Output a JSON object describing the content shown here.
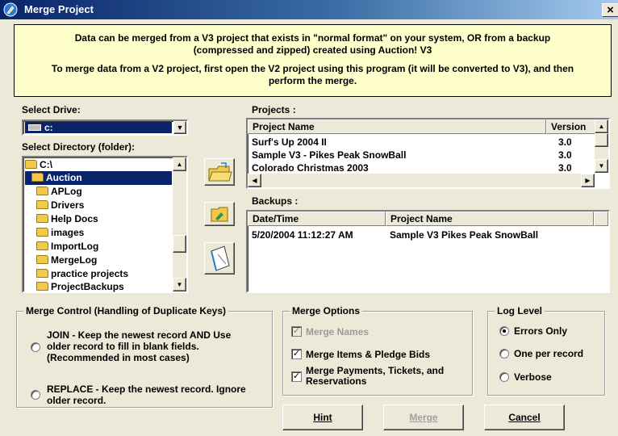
{
  "window": {
    "title": "Merge Project",
    "close_glyph": "×"
  },
  "info": {
    "line1": "Data can be merged from a V3 project that exists in \"normal format\" on your system, OR from a backup (compressed and zipped) created using Auction! V3",
    "line2": "To merge data from a V2 project, first open the V2 project using this program (it will be converted to V3), and then perform the merge."
  },
  "drive": {
    "label": "Select Drive:",
    "value": "c:",
    "icon": "drive-icon"
  },
  "directory": {
    "label": "Select Directory (folder):",
    "items": [
      "C:\\",
      "Auction",
      "APLog",
      "Drivers",
      "Help Docs",
      "images",
      "ImportLog",
      "MergeLog",
      "practice projects",
      "ProjectBackups"
    ],
    "selected": "Auction"
  },
  "projects": {
    "label": "Projects :",
    "columns": [
      "Project Name",
      "Version"
    ],
    "rows": [
      {
        "name": "Surf's Up 2004 II",
        "version": "3.0"
      },
      {
        "name": "Sample V3 - Pikes Peak SnowBall",
        "version": "3.0"
      },
      {
        "name": "Colorado Christmas 2003",
        "version": "3.0"
      }
    ]
  },
  "backups": {
    "label": "Backups :",
    "columns": [
      "Date/Time",
      "Project Name"
    ],
    "rows": [
      {
        "datetime": "5/20/2004 11:12:27 AM",
        "name": "Sample V3 Pikes Peak SnowBall"
      }
    ]
  },
  "merge_control": {
    "title": "Merge Control (Handling of Duplicate Keys)",
    "join": "JOIN - Keep the newest record AND Use older record to fill in blank fields. (Recommended in most cases)",
    "replace": "REPLACE - Keep the newest record. Ignore older record."
  },
  "merge_options": {
    "title": "Merge Options",
    "names": "Merge Names",
    "items": "Merge Items & Pledge Bids",
    "payments": "Merge Payments, Tickets, and Reservations",
    "check_glyph": "✓"
  },
  "log_level": {
    "title": "Log Level",
    "errors": "Errors Only",
    "per_record": "One per record",
    "verbose": "Verbose",
    "selected": "Errors Only"
  },
  "buttons": {
    "hint": "Hint",
    "merge": "Merge",
    "cancel": "Cancel"
  },
  "colors": {
    "title_bar": "#0a246a",
    "info_bg": "#ffffcc",
    "selection": "#0a246a",
    "face": "#ece9d8"
  }
}
